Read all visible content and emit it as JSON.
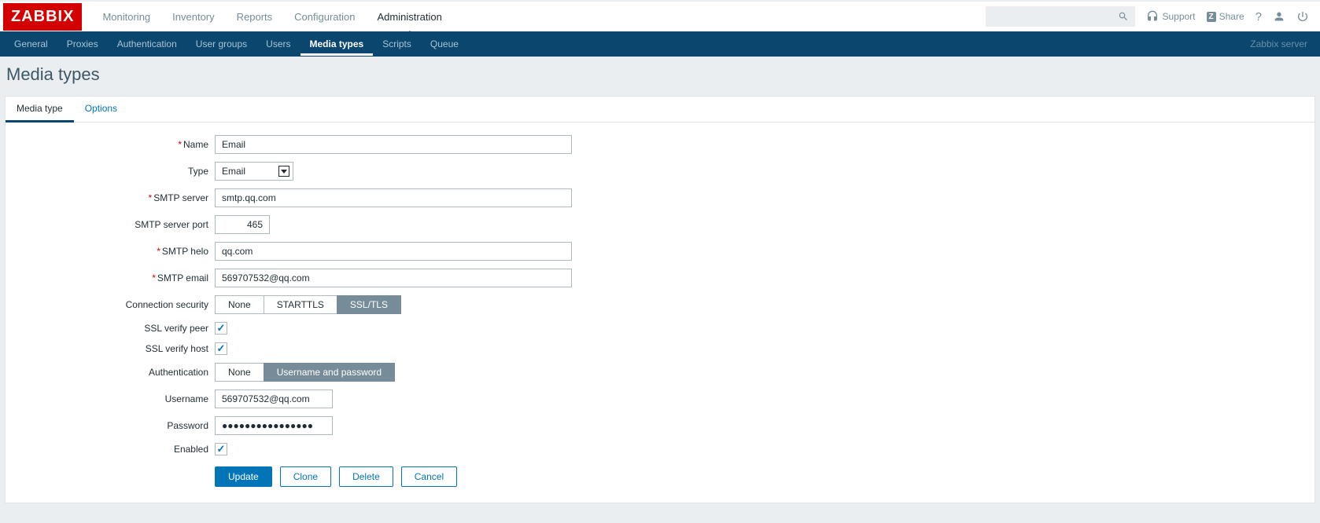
{
  "logo": "ZABBIX",
  "mainMenu": {
    "items": [
      "Monitoring",
      "Inventory",
      "Reports",
      "Configuration",
      "Administration"
    ],
    "active": 4
  },
  "topRight": {
    "support": "Support",
    "share": "Share"
  },
  "subMenu": {
    "items": [
      "General",
      "Proxies",
      "Authentication",
      "User groups",
      "Users",
      "Media types",
      "Scripts",
      "Queue"
    ],
    "active": 5,
    "serverLabel": "Zabbix server"
  },
  "pageTitle": "Media types",
  "tabs": {
    "items": [
      "Media type",
      "Options"
    ],
    "active": 0
  },
  "form": {
    "labels": {
      "name": "Name",
      "type": "Type",
      "smtpServer": "SMTP server",
      "smtpPort": "SMTP server port",
      "smtpHelo": "SMTP helo",
      "smtpEmail": "SMTP email",
      "connSecurity": "Connection security",
      "sslVerifyPeer": "SSL verify peer",
      "sslVerifyHost": "SSL verify host",
      "authentication": "Authentication",
      "username": "Username",
      "password": "Password",
      "enabled": "Enabled"
    },
    "values": {
      "name": "Email",
      "type": "Email",
      "smtpServer": "smtp.qq.com",
      "smtpPort": "465",
      "smtpHelo": "qq.com",
      "smtpEmail": "569707532@qq.com",
      "username": "569707532@qq.com",
      "password": "●●●●●●●●●●●●●●●●"
    },
    "connSecurity": {
      "options": [
        "None",
        "STARTTLS",
        "SSL/TLS"
      ],
      "active": 2
    },
    "authentication": {
      "options": [
        "None",
        "Username and password"
      ],
      "active": 1
    },
    "checks": {
      "sslVerifyPeer": true,
      "sslVerifyHost": true,
      "enabled": true
    }
  },
  "buttons": {
    "update": "Update",
    "clone": "Clone",
    "delete": "Delete",
    "cancel": "Cancel"
  }
}
